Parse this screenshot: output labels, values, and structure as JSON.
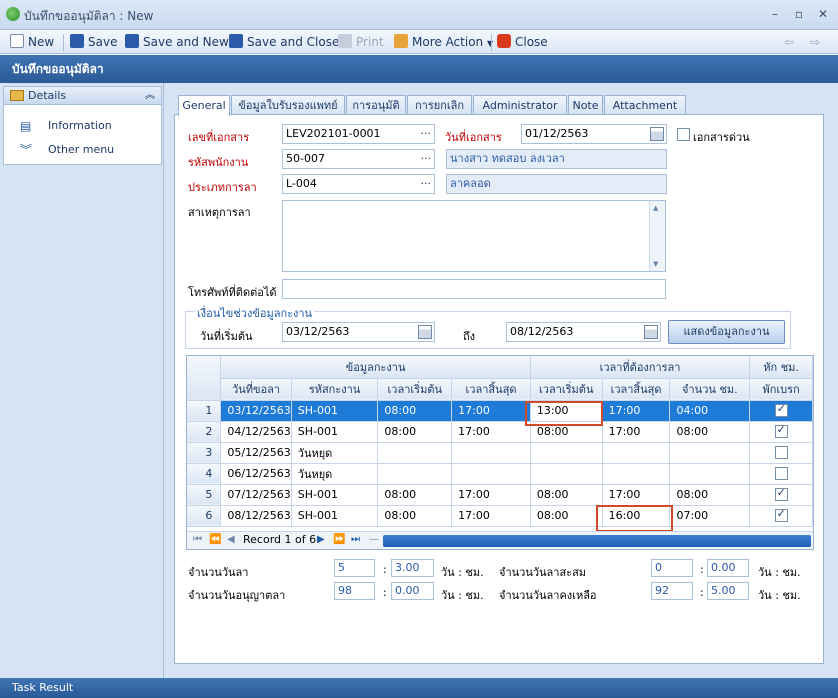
{
  "window": {
    "title": "บันทึกขออนุมัติลา : New"
  },
  "toolbar": {
    "new": "New",
    "save": "Save",
    "save_new": "Save and New",
    "save_close": "Save and Close",
    "print": "Print",
    "more": "More Action",
    "close": "Close"
  },
  "header": "บันทึกขออนุมัติลา",
  "sidebar": {
    "head": "Details",
    "items": [
      "Information",
      "Other menu"
    ]
  },
  "tabs": [
    "General",
    "ข้อมูลใบรับรองแพทย์",
    "การอนุมัติ",
    "การยกเลิก",
    "Administrator",
    "Note",
    "Attachment"
  ],
  "form": {
    "doc_no_label": "เลขที่เอกสาร",
    "doc_no": "LEV202101-0001",
    "doc_date_label": "วันที่เอกสาร",
    "doc_date": "01/12/2563",
    "urgent_label": "เอกสารด่วน",
    "emp_label": "รหัสพนักงาน",
    "emp_code": "50-007",
    "emp_name": "นางสาว ทดสอบ ลงเวลา",
    "type_label": "ประเภทการลา",
    "type_code": "L-004",
    "type_name": "ลาคลอด",
    "reason_label": "สาเหตุการลา",
    "phone_label": "โทรศัพท์ที่ติดต่อได้",
    "cond_title": "เงื่อนไขช่วงข้อมูลกะงาน",
    "start_label": "วันที่เริ่มต้น",
    "start": "03/12/2563",
    "to_label": "ถึง",
    "end": "08/12/2563",
    "show_btn": "แสดงข้อมูลกะงาน"
  },
  "grid": {
    "group1": "ข้อมูลกะงาน",
    "group2": "เวลาที่ต้องการลา",
    "group3": "หัก ชม.",
    "cols": [
      "วันที่ขอลา",
      "รหัสกะงาน",
      "เวลาเริ่มต้น",
      "เวลาสิ้นสุด",
      "เวลาเริ่มต้น",
      "เวลาสิ้นสุด",
      "จำนวน ชม.",
      "พักเบรก"
    ],
    "rows": [
      {
        "n": "1",
        "date": "03/12/2563",
        "shift": "SH-001",
        "s": "08:00",
        "e": "17:00",
        "ls": "13:00",
        "le": "17:00",
        "h": "04:00",
        "chk": true
      },
      {
        "n": "2",
        "date": "04/12/2563",
        "shift": "SH-001",
        "s": "08:00",
        "e": "17:00",
        "ls": "08:00",
        "le": "17:00",
        "h": "08:00",
        "chk": true
      },
      {
        "n": "3",
        "date": "05/12/2563",
        "shift": "วันหยุด",
        "s": "",
        "e": "",
        "ls": "",
        "le": "",
        "h": "",
        "chk": false
      },
      {
        "n": "4",
        "date": "06/12/2563",
        "shift": "วันหยุด",
        "s": "",
        "e": "",
        "ls": "",
        "le": "",
        "h": "",
        "chk": false
      },
      {
        "n": "5",
        "date": "07/12/2563",
        "shift": "SH-001",
        "s": "08:00",
        "e": "17:00",
        "ls": "08:00",
        "le": "17:00",
        "h": "08:00",
        "chk": true
      },
      {
        "n": "6",
        "date": "08/12/2563",
        "shift": "SH-001",
        "s": "08:00",
        "e": "17:00",
        "ls": "08:00",
        "le": "16:00",
        "h": "07:00",
        "chk": true
      }
    ],
    "record": "Record 1 of 6"
  },
  "summary": {
    "days_label": "จำนวนวันลา",
    "days": "5",
    "days_hours": "3.00",
    "approved_label": "จำนวนวันอนุญาตลา",
    "approved": "98",
    "approved_hours": "0.00",
    "accum_label": "จำนวนวันลาสะสม",
    "accum": "0",
    "accum_hours": "0.00",
    "remain_label": "จำนวนวันลาคงเหลือ",
    "remain": "92",
    "remain_hours": "5.00",
    "unit": "วัน : ชม.",
    "colon": ":"
  },
  "status": "Task Result"
}
